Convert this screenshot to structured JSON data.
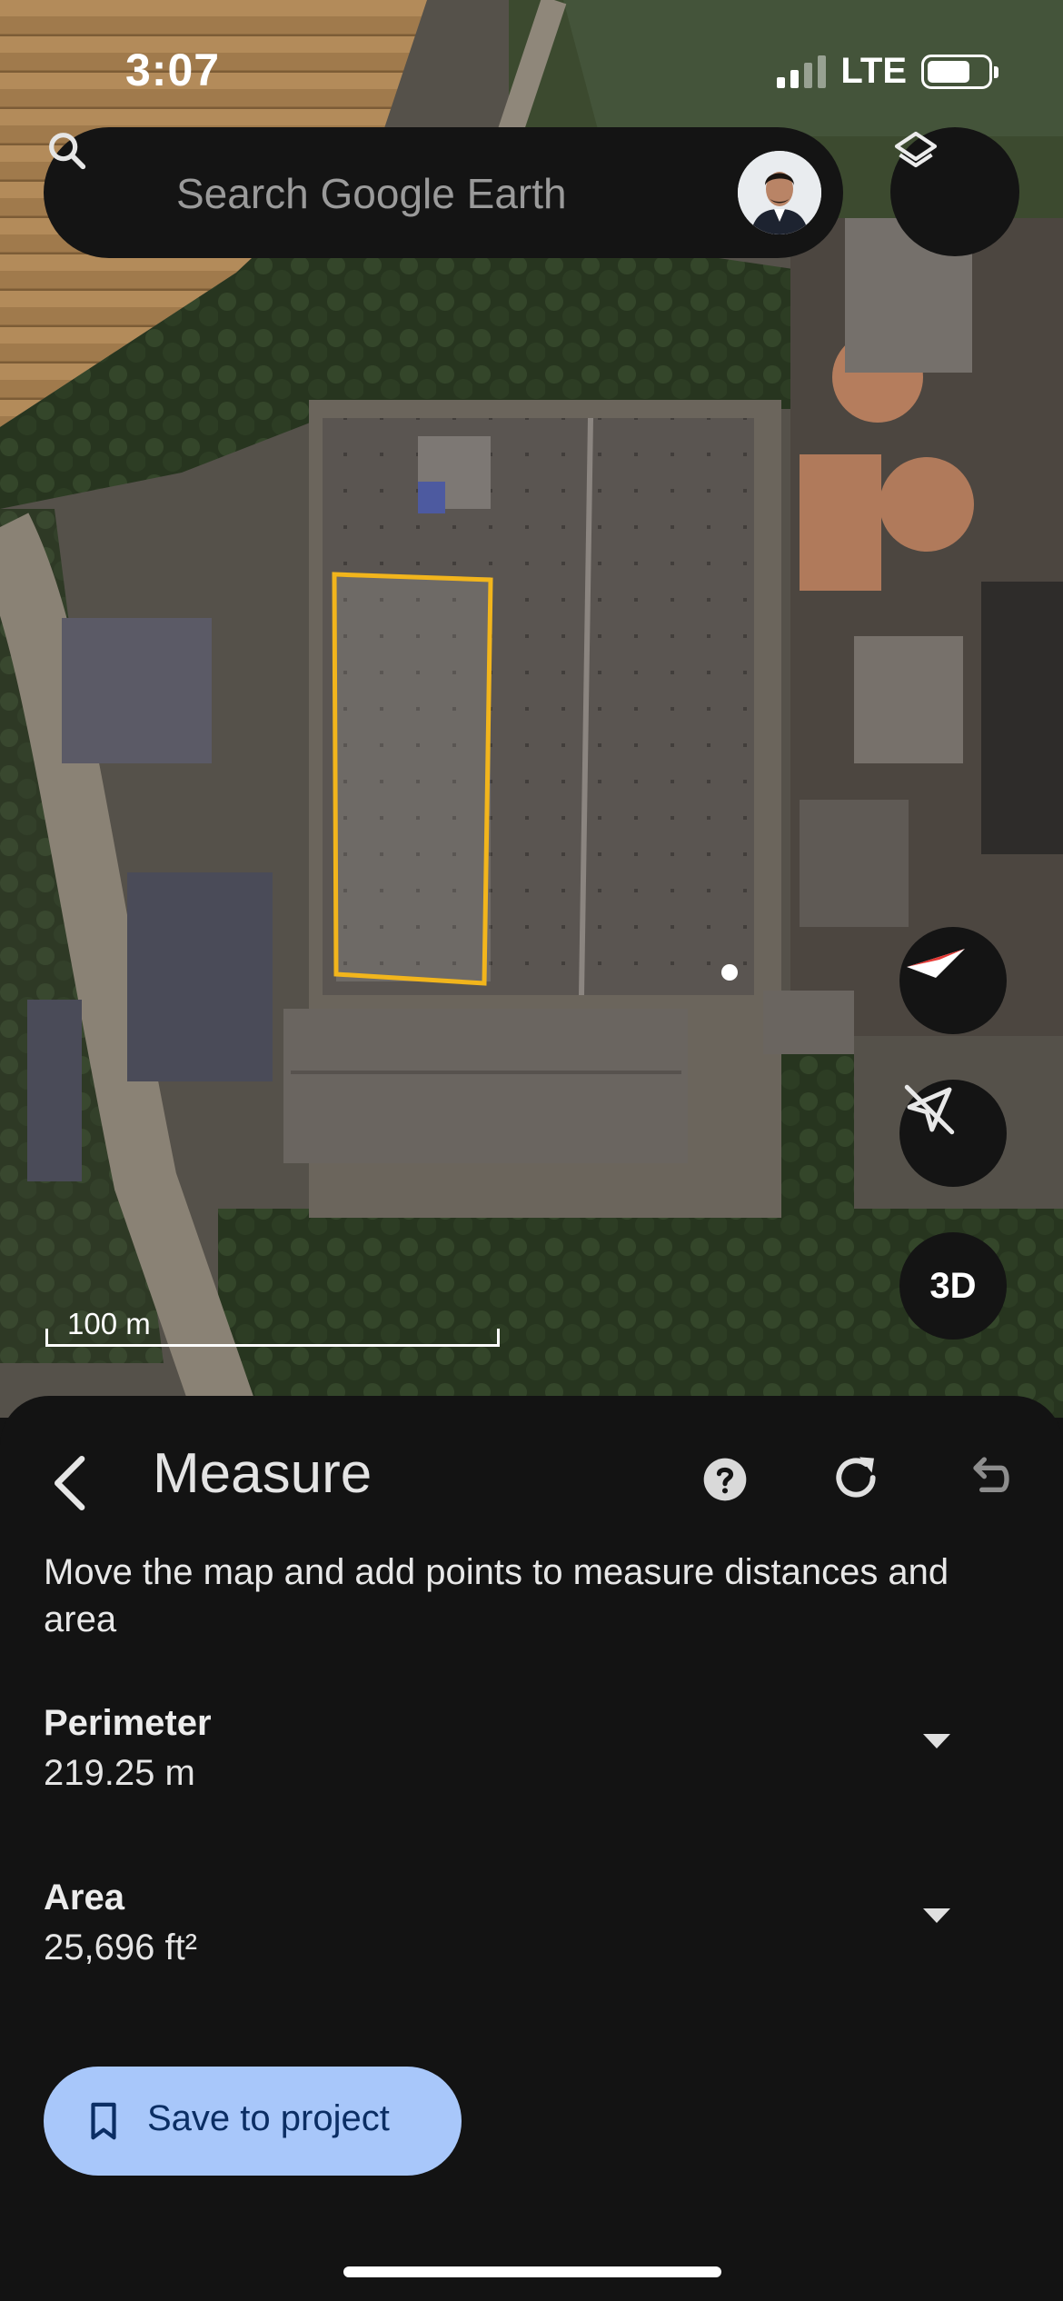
{
  "status_bar": {
    "time": "3:07",
    "network": "LTE"
  },
  "search": {
    "placeholder": "Search Google Earth"
  },
  "map": {
    "scale_label": "100 m",
    "three_d_label": "3D",
    "highlight_color": "#f2b51c"
  },
  "measure": {
    "title": "Measure",
    "description": "Move the map and add points to measure distances and area",
    "perimeter_label": "Perimeter",
    "perimeter_value": "219.25 m",
    "area_label": "Area",
    "area_value": "25,696 ft²",
    "save_label": "Save to project"
  },
  "colors": {
    "accent": "#a8c7fa",
    "accent_text": "#0b2e64",
    "sheet_bg": "#131313"
  }
}
